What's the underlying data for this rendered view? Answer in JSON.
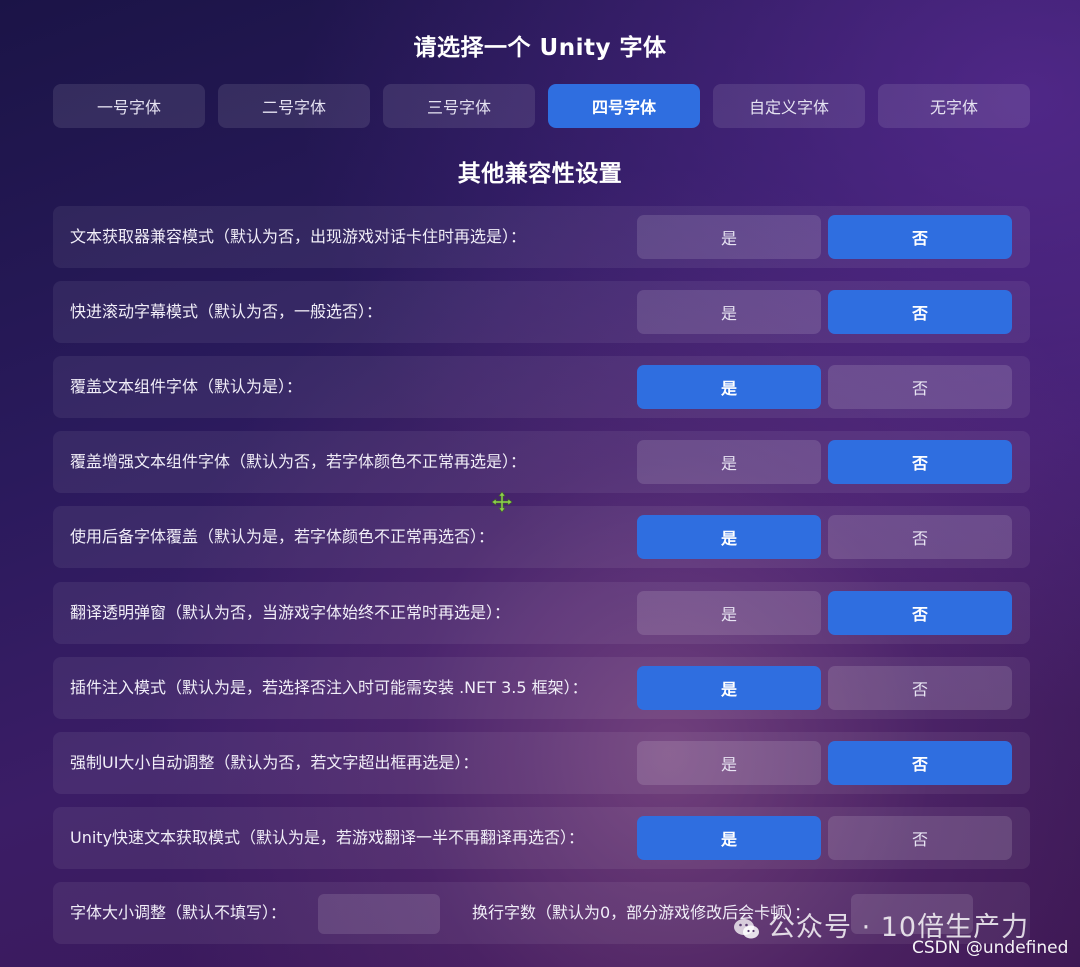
{
  "header": {
    "title": "请选择一个 Unity 字体"
  },
  "font_tabs": [
    {
      "label": "一号字体",
      "selected": false
    },
    {
      "label": "二号字体",
      "selected": false
    },
    {
      "label": "三号字体",
      "selected": false
    },
    {
      "label": "四号字体",
      "selected": true
    },
    {
      "label": "自定义字体",
      "selected": false
    },
    {
      "label": "无字体",
      "selected": false
    }
  ],
  "section": {
    "title": "其他兼容性设置"
  },
  "options": {
    "yes": "是",
    "no": "否"
  },
  "settings": [
    {
      "label": "文本获取器兼容模式（默认为否，出现游戏对话卡住时再选是）：",
      "value": "否"
    },
    {
      "label": "快进滚动字幕模式（默认为否，一般选否）：",
      "value": "否"
    },
    {
      "label": "覆盖文本组件字体（默认为是）：",
      "value": "是"
    },
    {
      "label": "覆盖增强文本组件字体（默认为否，若字体颜色不正常再选是）：",
      "value": "否"
    },
    {
      "label": "使用后备字体覆盖（默认为是，若字体颜色不正常再选否）：",
      "value": "是"
    },
    {
      "label": "翻译透明弹窗（默认为否，当游戏字体始终不正常时再选是）：",
      "value": "否"
    },
    {
      "label": "插件注入模式（默认为是，若选择否注入时可能需安装 .NET 3.5 框架）：",
      "value": "是"
    },
    {
      "label": "强制UI大小自动调整（默认为否，若文字超出框再选是）：",
      "value": "否"
    },
    {
      "label": "Unity快速文本获取模式（默认为是，若游戏翻译一半不再翻译再选否）：",
      "value": "是"
    }
  ],
  "font_size_row": {
    "font_size_label": "字体大小调整（默认不填写）：",
    "font_size_value": "",
    "line_break_label": "换行字数（默认为0，部分游戏修改后会卡顿）：",
    "line_break_value": ""
  },
  "watermark": {
    "text": "公众号 · 10倍生产力",
    "csdn": "CSDN @undefined"
  },
  "colors": {
    "accent": "#2f6ee0",
    "cursor": "#8fd14f"
  },
  "icons": {
    "cursor": "move-cursor-icon",
    "watermark": "wechat-icon"
  }
}
